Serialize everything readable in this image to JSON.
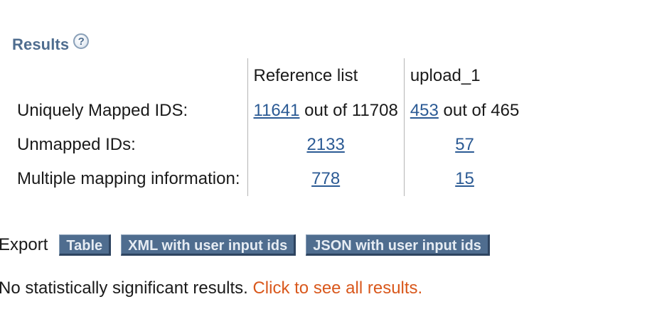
{
  "results": {
    "title": "Results",
    "help_glyph": "?"
  },
  "table": {
    "columns": [
      "Reference list",
      "upload_1"
    ],
    "rows": [
      {
        "label": "Uniquely Mapped IDS:",
        "ref_link": "11641",
        "ref_suffix": " out of 11708",
        "up_link": "453",
        "up_suffix": " out of 465"
      },
      {
        "label": "Unmapped IDs:",
        "ref_link": "2133",
        "up_link": "57"
      },
      {
        "label": "Multiple mapping information:",
        "ref_link": "778",
        "up_link": "15"
      }
    ]
  },
  "export": {
    "label": "Export",
    "buttons": [
      "Table",
      "XML with user input ids",
      "JSON with user input ids"
    ]
  },
  "message": {
    "text": "No statistically significant results. ",
    "link": "Click to see all results."
  },
  "colors": {
    "heading": "#4f6d8f",
    "link": "#2b5a94",
    "button_bg": "#4f6d8f",
    "orange_link": "#d9581c"
  }
}
